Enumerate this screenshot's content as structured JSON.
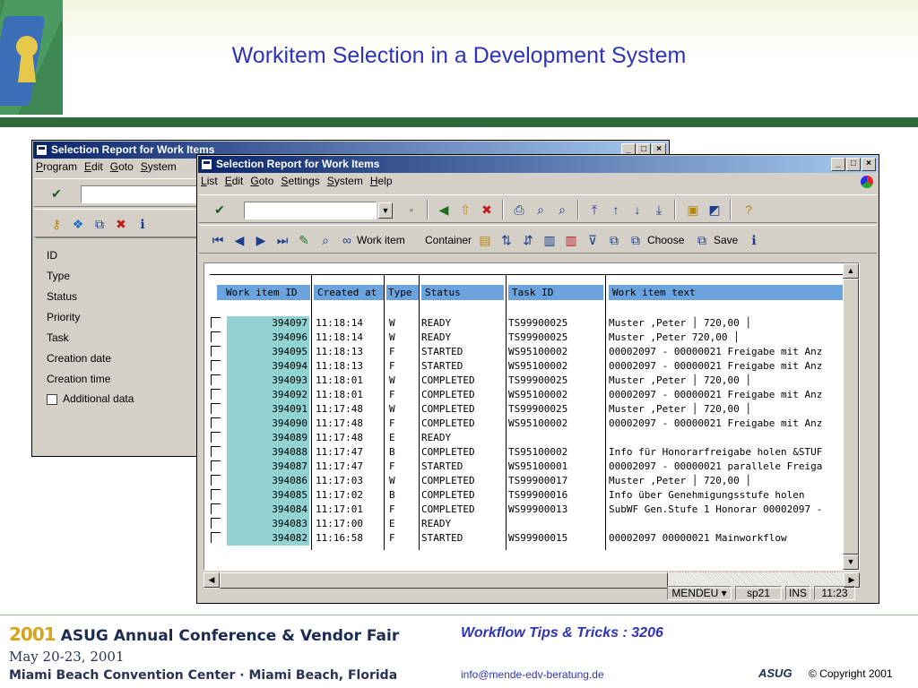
{
  "slide": {
    "title": "Workitem Selection in a Development System"
  },
  "footer": {
    "year": "2001",
    "conference": "ASUG Annual Conference & Vendor Fair",
    "dates": "May 20-23, 2001",
    "venue": "Miami Beach Convention Center · Miami Beach, Florida",
    "talk": "Workflow Tips & Tricks : 3206",
    "email": "info@mende-edv-beratung.de",
    "asug_logo": "ASUG",
    "copyright": "© Copyright 2001"
  },
  "back_window": {
    "title": "Selection Report for Work Items",
    "menu": [
      "Program",
      "Edit",
      "Goto",
      "System"
    ],
    "fields": [
      "ID",
      "Type",
      "Status",
      "Priority",
      "Task",
      "Creation date",
      "Creation time"
    ],
    "checkbox_label": "Additional data"
  },
  "front_window": {
    "title": "Selection Report for Work Items",
    "menu": [
      "List",
      "Edit",
      "Goto",
      "Settings",
      "System",
      "Help"
    ],
    "toolbar2": {
      "work_item": "Work item",
      "container": "Container",
      "choose": "Choose",
      "save": "Save"
    },
    "columns": [
      "Work item ID",
      "Created at",
      "Type",
      "Status",
      "Task ID",
      "Work item text"
    ],
    "rows": [
      {
        "id": "394097",
        "time": "11:18:14",
        "type": "W",
        "status": "READY",
        "task": "TS99900025",
        "text": "Muster      ,Peter       │ 720,00 │"
      },
      {
        "id": "394096",
        "time": "11:18:14",
        "type": "W",
        "status": "READY",
        "task": "TS99900025",
        "text": "Muster      ,Peter         720,00 │"
      },
      {
        "id": "394095",
        "time": "11:18:13",
        "type": "F",
        "status": "STARTED",
        "task": "WS95100002",
        "text": "00002097 - 00000021 Freigabe mit Anz"
      },
      {
        "id": "394094",
        "time": "11:18:13",
        "type": "F",
        "status": "STARTED",
        "task": "WS95100002",
        "text": "00002097 - 00000021 Freigabe mit Anz"
      },
      {
        "id": "394093",
        "time": "11:18:01",
        "type": "W",
        "status": "COMPLETED",
        "task": "TS99900025",
        "text": "Muster      ,Peter       │ 720,00 │"
      },
      {
        "id": "394092",
        "time": "11:18:01",
        "type": "F",
        "status": "COMPLETED",
        "task": "WS95100002",
        "text": "00002097 - 00000021 Freigabe mit Anz"
      },
      {
        "id": "394091",
        "time": "11:17:48",
        "type": "W",
        "status": "COMPLETED",
        "task": "TS99900025",
        "text": "Muster      ,Peter       │ 720,00 │"
      },
      {
        "id": "394090",
        "time": "11:17:48",
        "type": "F",
        "status": "COMPLETED",
        "task": "WS95100002",
        "text": "00002097 - 00000021 Freigabe mit Anz"
      },
      {
        "id": "394089",
        "time": "11:17:48",
        "type": "E",
        "status": "READY",
        "task": "",
        "text": ""
      },
      {
        "id": "394088",
        "time": "11:17:47",
        "type": "B",
        "status": "COMPLETED",
        "task": "TS95100002",
        "text": "Info für Honorarfreigabe holen &STUF"
      },
      {
        "id": "394087",
        "time": "11:17:47",
        "type": "F",
        "status": "STARTED",
        "task": "WS95100001",
        "text": "00002097 - 00000021 parallele Freiga"
      },
      {
        "id": "394086",
        "time": "11:17:03",
        "type": "W",
        "status": "COMPLETED",
        "task": "TS99900017",
        "text": "Muster      ,Peter       │ 720,00 │"
      },
      {
        "id": "394085",
        "time": "11:17:02",
        "type": "B",
        "status": "COMPLETED",
        "task": "TS99900016",
        "text": "Info über Genehmigungsstufe holen"
      },
      {
        "id": "394084",
        "time": "11:17:01",
        "type": "F",
        "status": "COMPLETED",
        "task": "WS99900013",
        "text": "SubWF Gen.Stufe 1 Honorar 00002097 -"
      },
      {
        "id": "394083",
        "time": "11:17:00",
        "type": "E",
        "status": "READY",
        "task": "",
        "text": ""
      },
      {
        "id": "394082",
        "time": "11:16:58",
        "type": "F",
        "status": "STARTED",
        "task": "WS99900015",
        "text": "00002097 00000021 Mainworkflow"
      }
    ],
    "status_bar": {
      "user": "MENDEU",
      "system": "sp21",
      "mode": "INS",
      "time": "11:23"
    }
  },
  "colors": {
    "title_blue": "#2e33b8",
    "header_green": "#2f6a3d",
    "id_cell": "#91d3d3",
    "column_header": "#6aa3dd"
  }
}
